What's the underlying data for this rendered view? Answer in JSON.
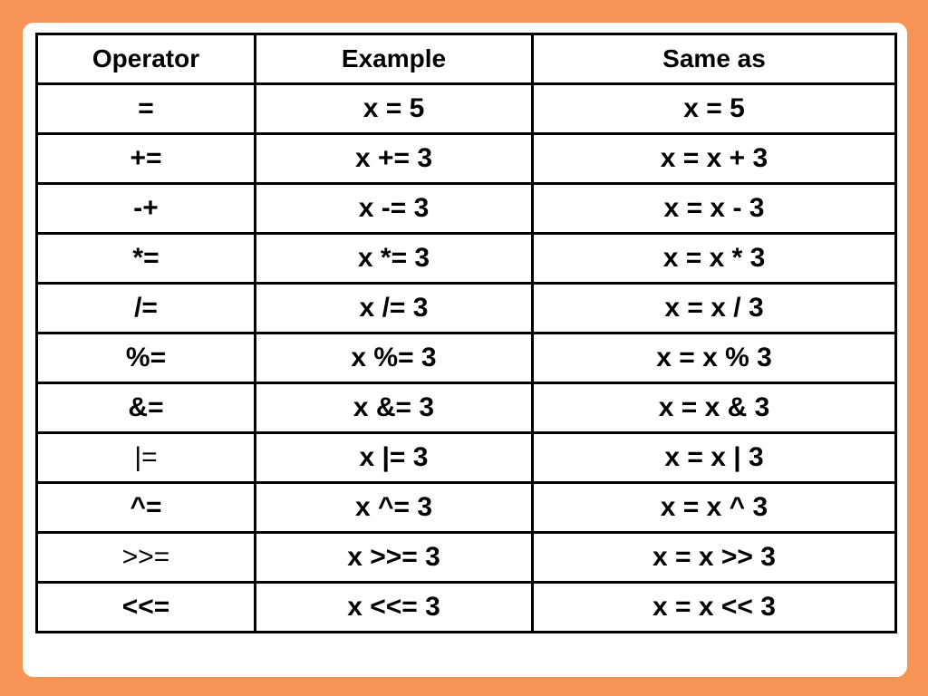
{
  "colors": {
    "background": "#F79455",
    "card": "#FFFFFF",
    "border": "#000000",
    "text": "#000000"
  },
  "table": {
    "headers": [
      "Operator",
      "Example",
      "Same as"
    ],
    "rows": [
      {
        "operator": "=",
        "example": "x = 5",
        "same_as": "x = 5"
      },
      {
        "operator": "+=",
        "example": "x += 3",
        "same_as": "x = x + 3"
      },
      {
        "operator": "-+",
        "example": "x -= 3",
        "same_as": "x = x - 3"
      },
      {
        "operator": "*=",
        "example": "x *= 3",
        "same_as": "x = x * 3"
      },
      {
        "operator": "/=",
        "example": "x /= 3",
        "same_as": "x = x / 3"
      },
      {
        "operator": "%=",
        "example": "x %= 3",
        "same_as": "x = x % 3"
      },
      {
        "operator": "&=",
        "example": "x &= 3",
        "same_as": "x = x & 3"
      },
      {
        "operator": "|=",
        "example": "x |= 3",
        "same_as": "x = x | 3"
      },
      {
        "operator": "^=",
        "example": "x ^= 3",
        "same_as": "x = x ^ 3"
      },
      {
        "operator": ">>=",
        "example": "x >>= 3",
        "same_as": "x = x >> 3"
      },
      {
        "operator": "<<=",
        "example": "x <<= 3",
        "same_as": "x = x << 3"
      }
    ]
  }
}
